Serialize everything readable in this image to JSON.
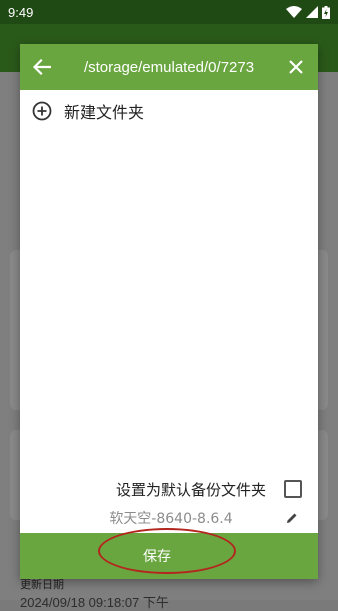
{
  "status_bar": {
    "time": "9:49"
  },
  "dialog": {
    "path": "/storage/emulated/0/7273",
    "new_folder_label": "新建文件夹",
    "default_folder_label": "设置为默认备份文件夹",
    "file_name": "软天空-8640-8.6.4",
    "save_label": "保存"
  },
  "background": {
    "update_date_label": "更新日期",
    "update_date_value": "2024/09/18 09:18:07 下午"
  },
  "colors": {
    "accent": "#6aa640",
    "statusbar": "#1f4a14",
    "annotation": "#b3261e"
  }
}
